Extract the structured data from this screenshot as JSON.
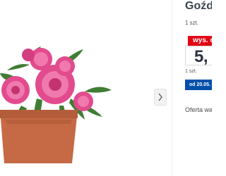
{
  "product": {
    "title": "Goździk",
    "unit_top": "1 szt.",
    "promo_label": "wys. c",
    "price": "5,",
    "unit_bottom": "1 szt.",
    "date_label": "od 20.05.",
    "offer_note": "Oferta ważna"
  },
  "gallery": {
    "photo_icon": "carnation-pot-photo",
    "next_icon": "chevron-right-icon"
  },
  "colors": {
    "promo_red": "#e30613",
    "date_blue": "#0050aa",
    "title_text": "#3a4450"
  }
}
